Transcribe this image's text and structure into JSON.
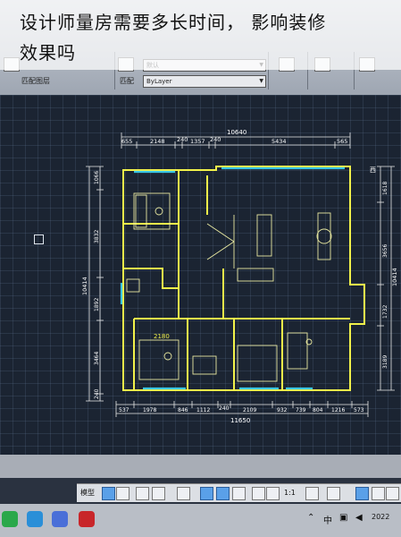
{
  "caption": {
    "line1": "设计师量房需要多长时间， 影响装修",
    "line2": "效果吗"
  },
  "ribbon": {
    "match_label": "匹配",
    "layer_value": "ByLayer",
    "default_value": "默认",
    "row2_left": "匹配图层"
  },
  "drawing": {
    "dim_top_total": "10640",
    "dim_top": [
      "655",
      "2148",
      "240",
      "1357",
      "240",
      "5434",
      "565"
    ],
    "dim_bottom_total": "11650",
    "dim_bottom": [
      "537",
      "1978",
      "846",
      "1112",
      "240",
      "2109",
      "932",
      "739",
      "804",
      "1216",
      "573"
    ],
    "dim_left_total": "10414",
    "dim_left": [
      "1066",
      "3832",
      "1892",
      "3464",
      "240"
    ],
    "dim_right_total": "10414",
    "dim_right": [
      "1618",
      "3656",
      "1732",
      "3189"
    ],
    "room_text": "2180",
    "west_label": "西"
  },
  "statusbar": {
    "model_label": "模型",
    "scale_label": "1:1"
  },
  "taskbar": {
    "ime_label": "中",
    "date_fragment": "2022"
  },
  "colors": {
    "wall": "#f2f24a",
    "dimension": "#ffffff",
    "window": "#39c6e6",
    "background": "#1b2432"
  }
}
